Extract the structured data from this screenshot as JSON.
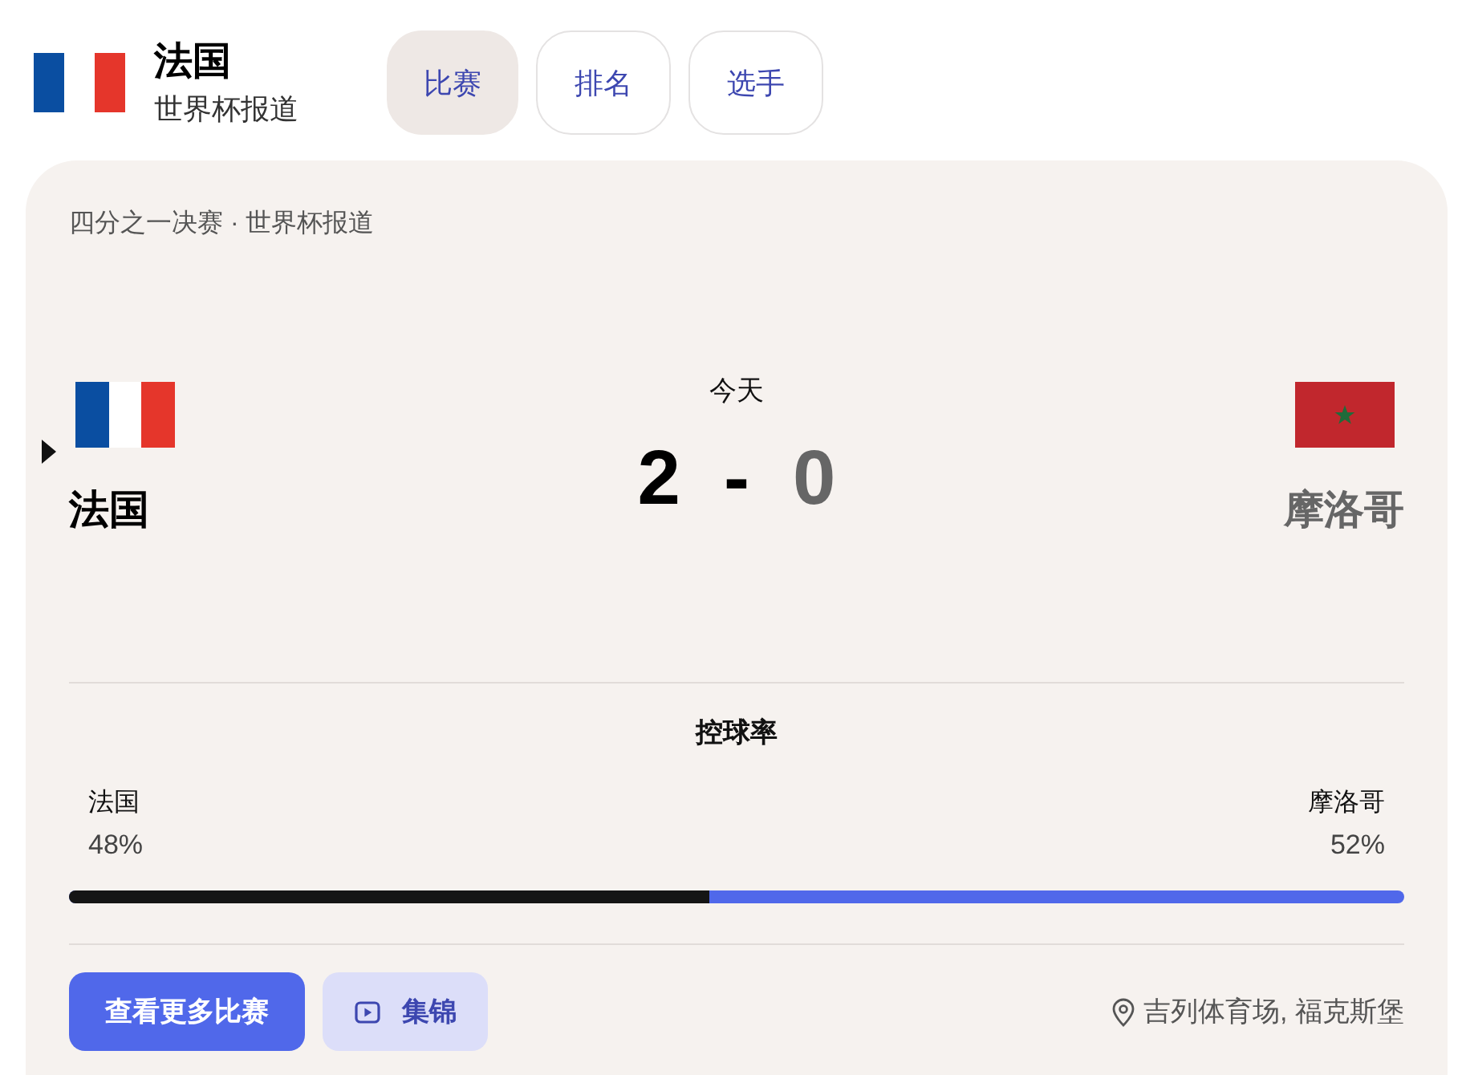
{
  "header": {
    "team": "法国",
    "subtitle": "世界杯报道",
    "tabs": [
      {
        "label": "比赛",
        "selected": true
      },
      {
        "label": "排名",
        "selected": false
      },
      {
        "label": "选手",
        "selected": false
      }
    ]
  },
  "match": {
    "stage": "四分之一决赛 · 世界杯报道",
    "date": "今天",
    "separator": "-",
    "home": {
      "name": "法国",
      "score": "2",
      "winner": true
    },
    "away": {
      "name": "摩洛哥",
      "score": "0",
      "winner": false
    }
  },
  "possession": {
    "title": "控球率",
    "level": 0.48,
    "home": {
      "name": "法国",
      "reading": "48%"
    },
    "away": {
      "name": "摩洛哥",
      "reading": "52%"
    }
  },
  "actions": [
    {
      "label": "查看更多比赛",
      "kind": "primary"
    },
    {
      "label": "集锦",
      "kind": "video"
    }
  ],
  "venue": "吉列体育场, 福克斯堡"
}
